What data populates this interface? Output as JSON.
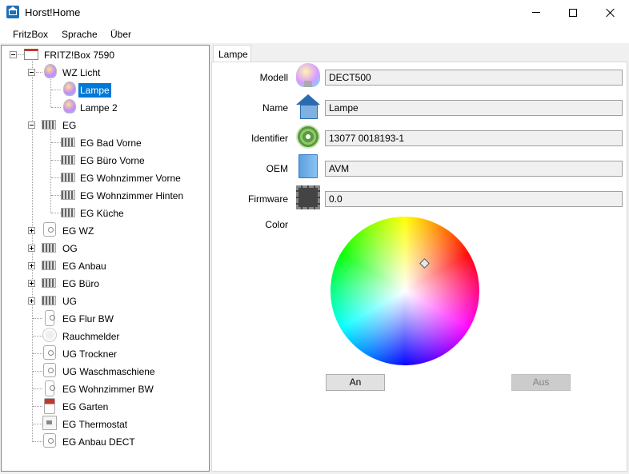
{
  "window": {
    "title": "Horst!Home"
  },
  "menu": {
    "items": [
      "FritzBox",
      "Sprache",
      "Über"
    ]
  },
  "tree": {
    "root": "FRITZ!Box 7590",
    "wz_licht": "WZ Licht",
    "lampe": "Lampe",
    "lampe2": "Lampe 2",
    "eg": "EG",
    "eg_children": [
      "EG Bad Vorne",
      "EG Büro Vorne",
      "EG Wohnzimmer Vorne",
      "EG Wohnzimmer Hinten",
      "EG Küche"
    ],
    "groups": [
      "EG WZ",
      "OG",
      "EG Anbau",
      "EG Büro",
      "UG"
    ],
    "devices": [
      "EG Flur BW",
      "Rauchmelder",
      "UG Trockner",
      "UG Waschmaschiene",
      "EG Wohnzimmer BW",
      "EG Garten",
      "EG Thermostat",
      "EG Anbau DECT"
    ]
  },
  "tab": {
    "label": "Lampe"
  },
  "properties": {
    "modell_label": "Modell",
    "modell_value": "DECT500",
    "name_label": "Name",
    "name_value": "Lampe",
    "identifier_label": "Identifier",
    "identifier_value": "13077 0018193-1",
    "oem_label": "OEM",
    "oem_value": "AVM",
    "firmware_label": "Firmware",
    "firmware_value": "0.0",
    "color_label": "Color"
  },
  "buttons": {
    "on_label": "An",
    "off_label": "Aus"
  }
}
